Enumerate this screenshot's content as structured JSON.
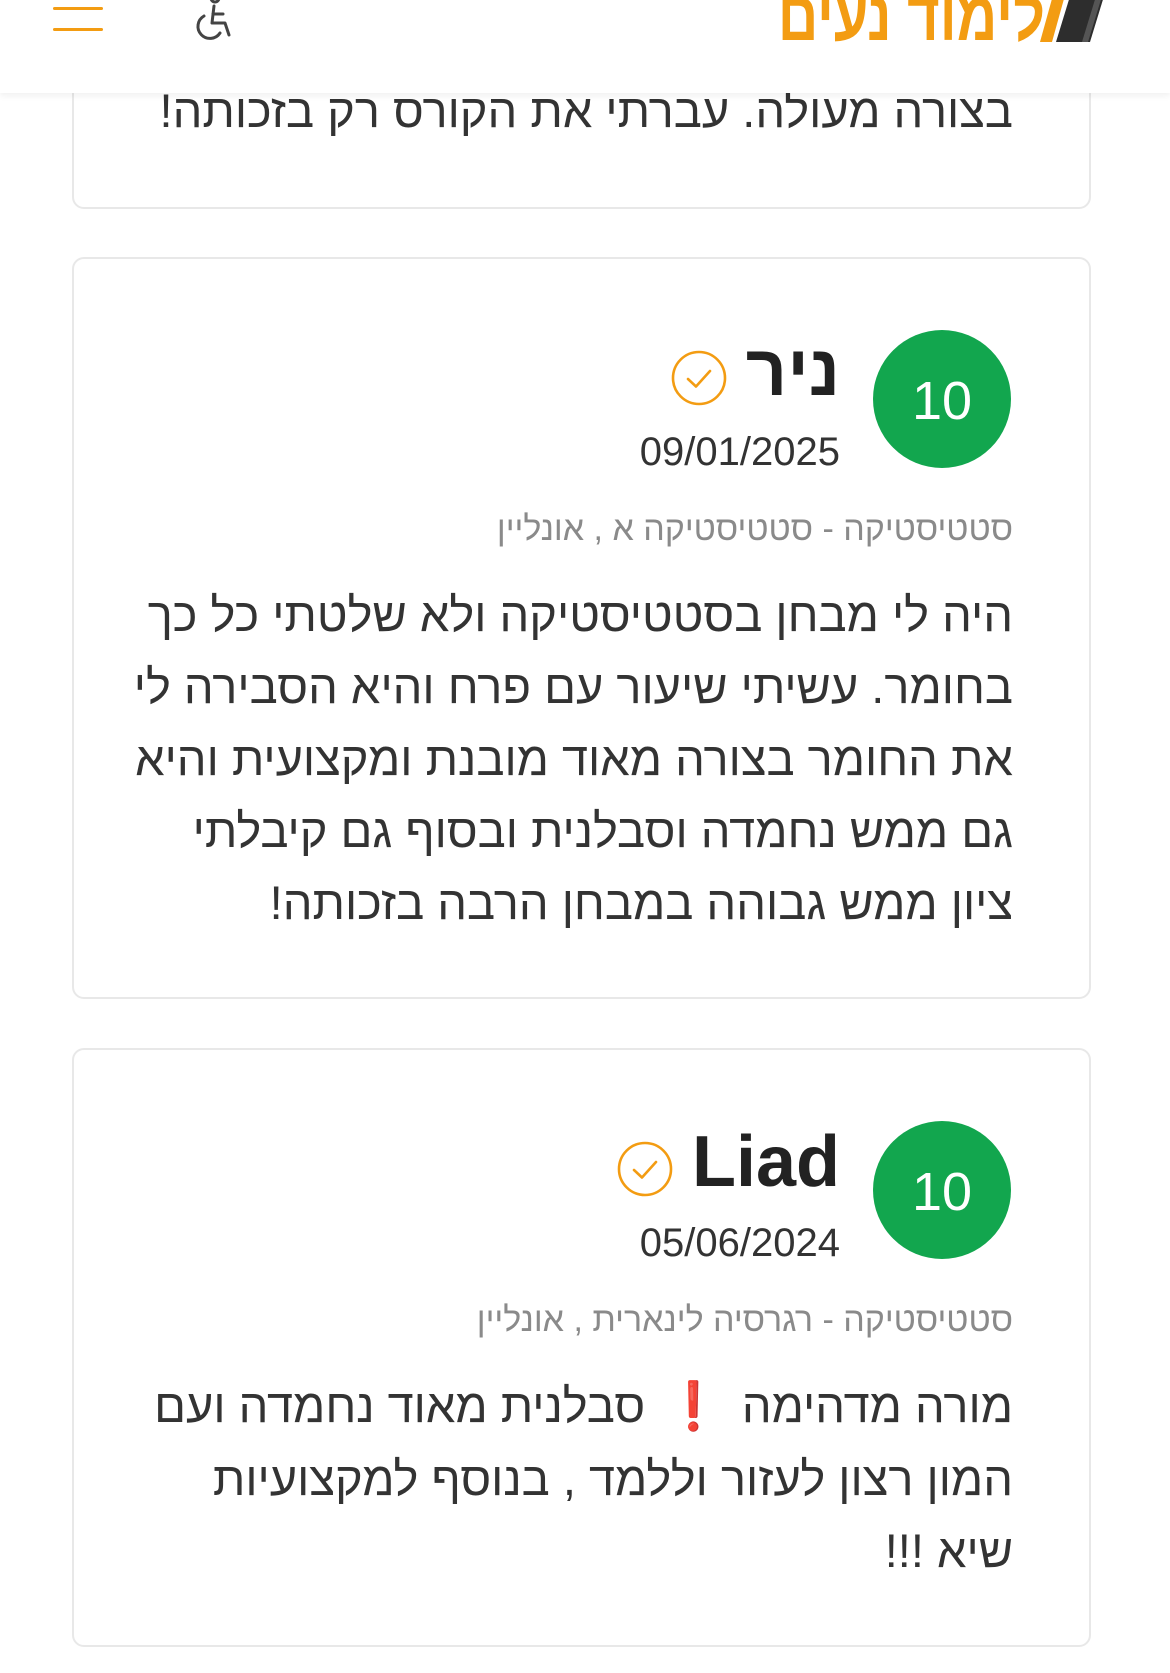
{
  "header": {
    "logo_text": "לימוד נעים",
    "menu_icon": "hamburger-menu-icon",
    "accessibility_icon": "wheelchair-accessibility-icon",
    "logo_icon": "book-logo-icon"
  },
  "colors": {
    "accent": "#f39c12",
    "score_badge": "#12a64e",
    "text": "#333333",
    "muted": "#8a8a8a"
  },
  "reviews": [
    {
      "body": "בצורה מעולה. עברתי את הקורס רק בזכותה!"
    },
    {
      "score": "10",
      "name": "ניר",
      "verified_icon": "check-circle-icon",
      "date": "09/01/2025",
      "course": "סטטיסטיקה - סטטיסטיקה א , אונליין",
      "body": "היה לי מבחן בסטטיסטיקה ולא שלטתי כל כך\nבחומר. עשיתי שיעור עם פרח והיא הסבירה לי\nאת החומר בצורה מאוד מובנת ומקצועית והיא\nגם ממש נחמדה וסבלנית ובסוף גם קיבלתי\nציון ממש גבוהה במבחן הרבה בזכותה!"
    },
    {
      "score": "10",
      "name": "Liad",
      "verified_icon": "check-circle-icon",
      "date": "05/06/2024",
      "course": "סטטיסטיקה - רגרסיה לינארית , אונליין",
      "body": "מורה מדהימה ❗️ סבלנית מאוד נחמדה ועם\nהמון רצון לעזור וללמד , בנוסף למקצועיות\nשיא !!!"
    }
  ]
}
